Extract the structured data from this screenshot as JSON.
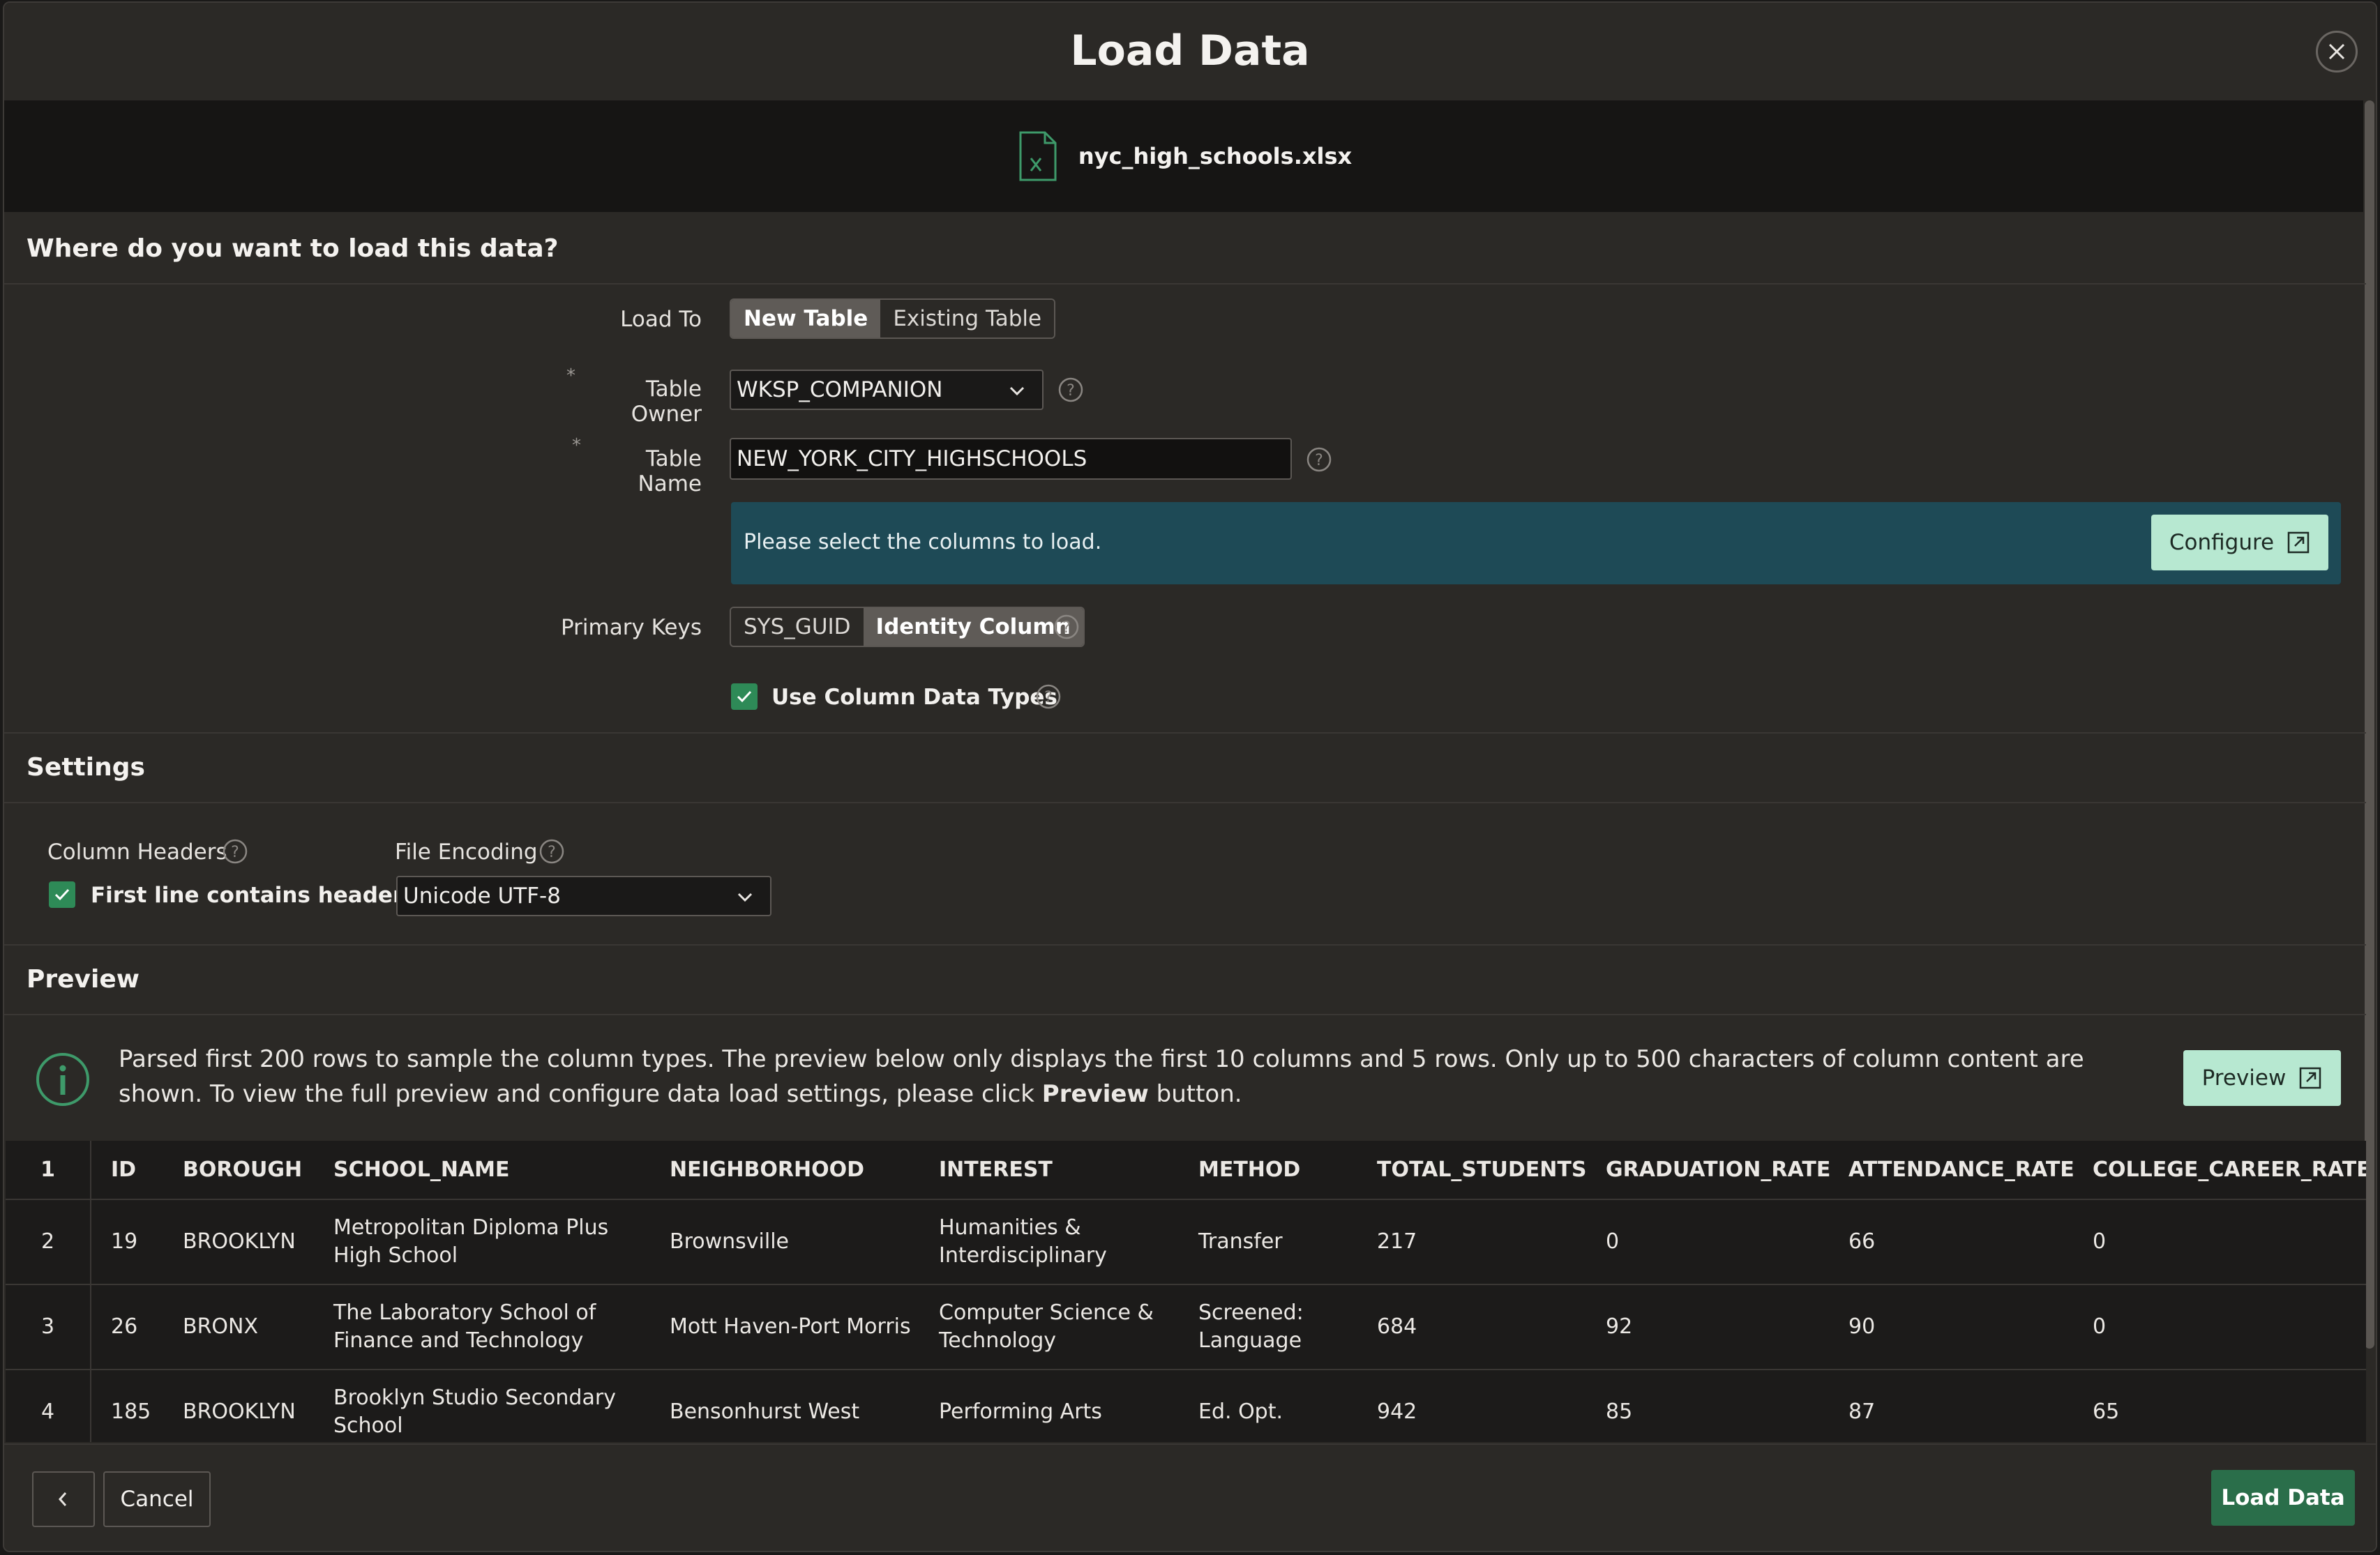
{
  "dialog": {
    "title": "Load Data",
    "file_name": "nyc_high_schools.xlsx"
  },
  "destination": {
    "heading": "Where do you want to load this data?",
    "load_to_label": "Load To",
    "load_to_options": [
      "New Table",
      "Existing Table"
    ],
    "load_to_selected": "New Table",
    "table_owner_label": "Table Owner",
    "table_owner_value": "WKSP_COMPANION",
    "table_name_label": "Table Name",
    "table_name_value": "NEW_YORK_CITY_HIGHSCHOOLS",
    "required_mark": "*",
    "notice_text": "Please select the columns to load.",
    "configure_label": "Configure",
    "primary_keys_label": "Primary Keys",
    "primary_keys_options": [
      "SYS_GUID",
      "Identity Column"
    ],
    "primary_keys_selected": "Identity Column",
    "use_column_types_label": "Use Column Data Types",
    "use_column_types_checked": true
  },
  "settings": {
    "heading": "Settings",
    "column_headers_label": "Column Headers",
    "first_line_headers_label": "First line contains headers",
    "first_line_headers_checked": true,
    "file_encoding_label": "File Encoding",
    "file_encoding_value": "Unicode UTF-8"
  },
  "preview": {
    "heading": "Preview",
    "info_text_1": "Parsed first 200 rows to sample the column types. The preview below only displays the first 10 columns and 5 rows. Only up to 500 characters of column content are shown. To view the full preview and configure data load settings, please click ",
    "info_text_bold": "Preview",
    "info_text_2": " button.",
    "preview_button_label": "Preview",
    "header_row_number": "1",
    "columns": [
      "ID",
      "BOROUGH",
      "SCHOOL_NAME",
      "NEIGHBORHOOD",
      "INTEREST",
      "METHOD",
      "TOTAL_STUDENTS",
      "GRADUATION_RATE",
      "ATTENDANCE_RATE",
      "COLLEGE_CAREER_RATE"
    ],
    "rows": [
      {
        "n": "2",
        "cells": [
          "19",
          "BROOKLYN",
          "Metropolitan Diploma Plus High School",
          "Brownsville",
          "Humanities & Interdisciplinary",
          "Transfer",
          "217",
          "0",
          "66",
          "0"
        ]
      },
      {
        "n": "3",
        "cells": [
          "26",
          "BRONX",
          "The Laboratory School of Finance and Technology",
          "Mott Haven-Port Morris",
          "Computer Science & Technology",
          "Screened: Language",
          "684",
          "92",
          "90",
          "0"
        ]
      },
      {
        "n": "4",
        "cells": [
          "185",
          "BROOKLYN",
          "Brooklyn Studio Secondary School",
          "Bensonhurst West",
          "Performing Arts",
          "Ed. Opt.",
          "942",
          "85",
          "87",
          "65"
        ]
      }
    ]
  },
  "footer": {
    "cancel_label": "Cancel",
    "load_label": "Load Data"
  },
  "colors": {
    "accent_green": "#2a6e4a",
    "mint_button": "#b7e8d1",
    "notice_bg": "#1e4a56",
    "checkbox": "#2e8a57"
  }
}
